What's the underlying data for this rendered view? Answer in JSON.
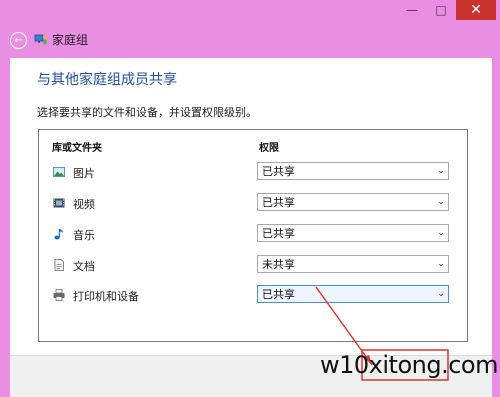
{
  "titlebar": {
    "min_glyph": "—",
    "max_glyph": "□",
    "close_glyph": "✕"
  },
  "header": {
    "back_glyph": "←",
    "title": "家庭组"
  },
  "main": {
    "heading": "与其他家庭组成员共享",
    "description": "选择要共享的文件和设备，并设置权限级别。",
    "columns": {
      "name": "库或文件夹",
      "permission": "权限"
    },
    "rows": [
      {
        "name": "图片",
        "permission": "已共享",
        "icon": "pictures-icon"
      },
      {
        "name": "视频",
        "permission": "已共享",
        "icon": "videos-icon"
      },
      {
        "name": "音乐",
        "permission": "已共享",
        "icon": "music-icon"
      },
      {
        "name": "文档",
        "permission": "未共享",
        "icon": "documents-icon"
      },
      {
        "name": "打印机和设备",
        "permission": "已共享",
        "icon": "printer-icon"
      }
    ]
  },
  "watermark": "w10xitong.com",
  "colors": {
    "window_frame": "#e98ee3",
    "heading": "#1f4fa2",
    "close_button": "#c7322c",
    "annotation_arrow": "#d9372f"
  }
}
